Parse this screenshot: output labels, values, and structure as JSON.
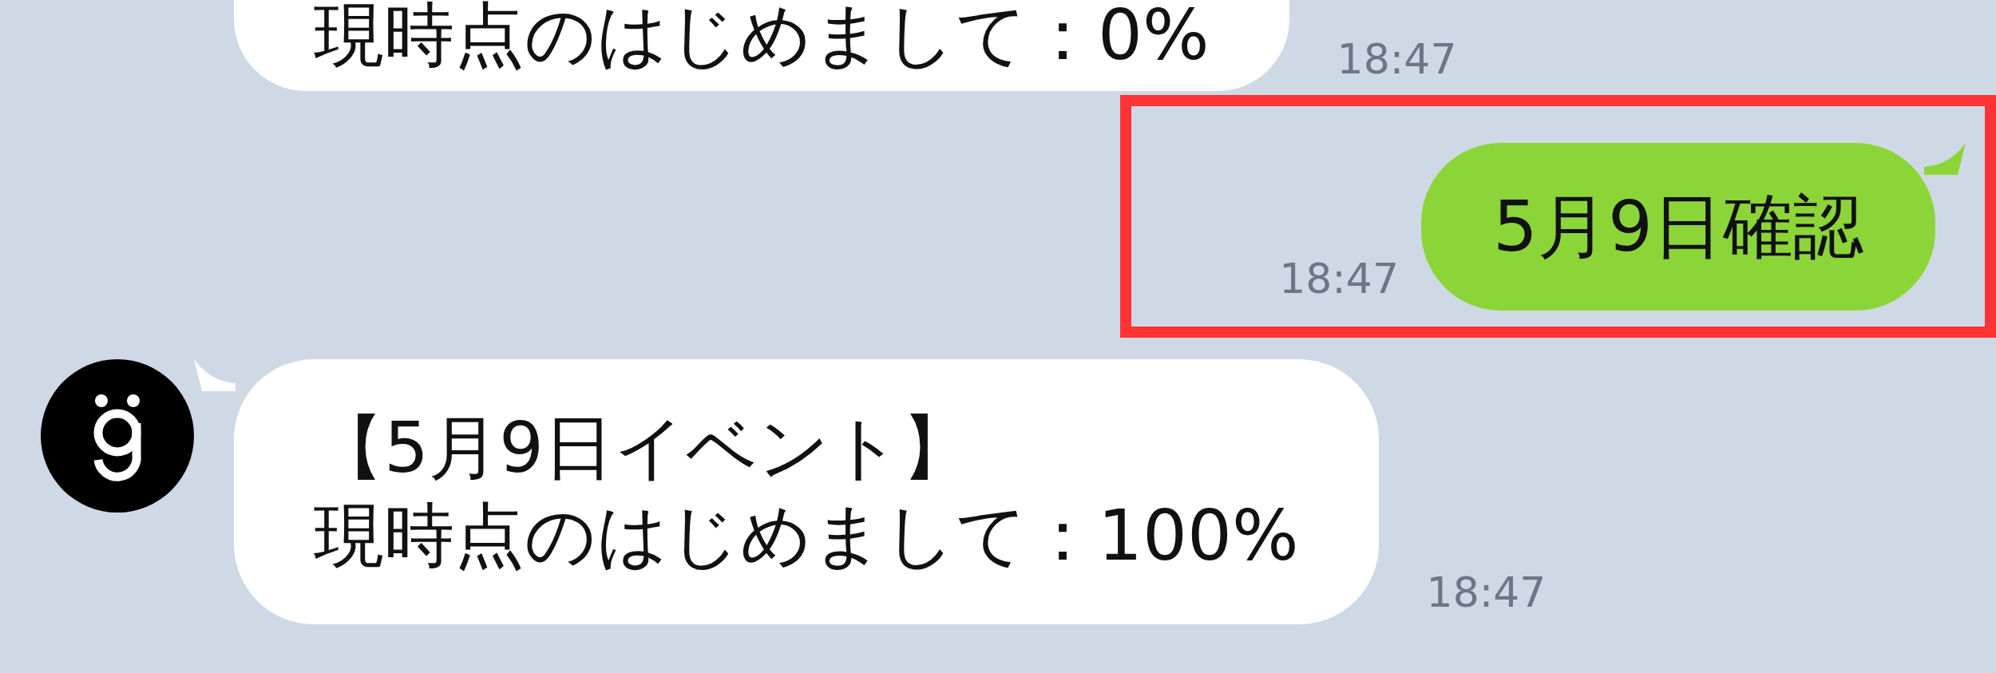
{
  "messages": [
    {
      "kind": "incoming",
      "avatar": false,
      "lines": [
        "現時点のはじめまして：0%"
      ],
      "time": "18:47"
    },
    {
      "kind": "outgoing",
      "lines": [
        "5月9日確認"
      ],
      "time": "18:47",
      "highlighted": true
    },
    {
      "kind": "incoming",
      "avatar": true,
      "lines": [
        "【5月9日イベント】",
        "現時点のはじめまして：100%"
      ],
      "time": "18:47"
    }
  ]
}
